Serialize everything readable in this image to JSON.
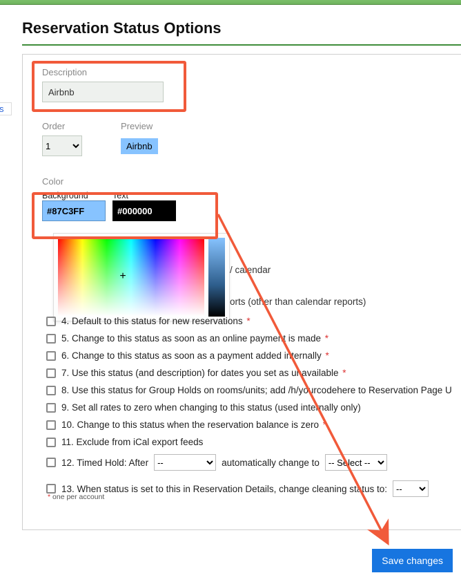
{
  "page": {
    "title": "Reservation Status Options",
    "left_stub": "s"
  },
  "description": {
    "label": "Description",
    "value": "Airbnb"
  },
  "order": {
    "label": "Order",
    "value": "1"
  },
  "preview": {
    "label": "Preview",
    "value": "Airbnb"
  },
  "color": {
    "label": "Color",
    "bg_label": "Background",
    "text_label": "Text",
    "bg_value": "#87C3FF",
    "text_value": "#000000"
  },
  "partial_lines": {
    "calendar": "/ calendar",
    "reports": "orts (other than calendar reports)"
  },
  "checkboxes": [
    {
      "n": 4,
      "text": "Default to this status for new reservations",
      "req": true
    },
    {
      "n": 5,
      "text": "Change to this status as soon as an online payment is made",
      "req": true
    },
    {
      "n": 6,
      "text": "Change to this status as soon as a payment added internally",
      "req": true
    },
    {
      "n": 7,
      "text": "Use this status (and description) for dates you set as unavailable",
      "req": true
    },
    {
      "n": 8,
      "text": "Use this status for Group Holds on rooms/units; add /h/yourcodehere to Reservation Page U",
      "req": false
    },
    {
      "n": 9,
      "text": "Set all rates to zero when changing to this status (used internally only)",
      "req": false
    },
    {
      "n": 10,
      "text": "Change to this status when the reservation balance is zero",
      "req": true
    },
    {
      "n": 11,
      "text": "Exclude from iCal export feeds",
      "req": false
    }
  ],
  "row12": {
    "prefix": "12. Timed Hold: After",
    "mid": "automatically change to",
    "select1": "--",
    "select2": "-- Select --"
  },
  "row13": {
    "text": "13. When status is set to this in Reservation Details, change cleaning status to:",
    "select": "--"
  },
  "footnote": "one per account",
  "save": "Save changes"
}
